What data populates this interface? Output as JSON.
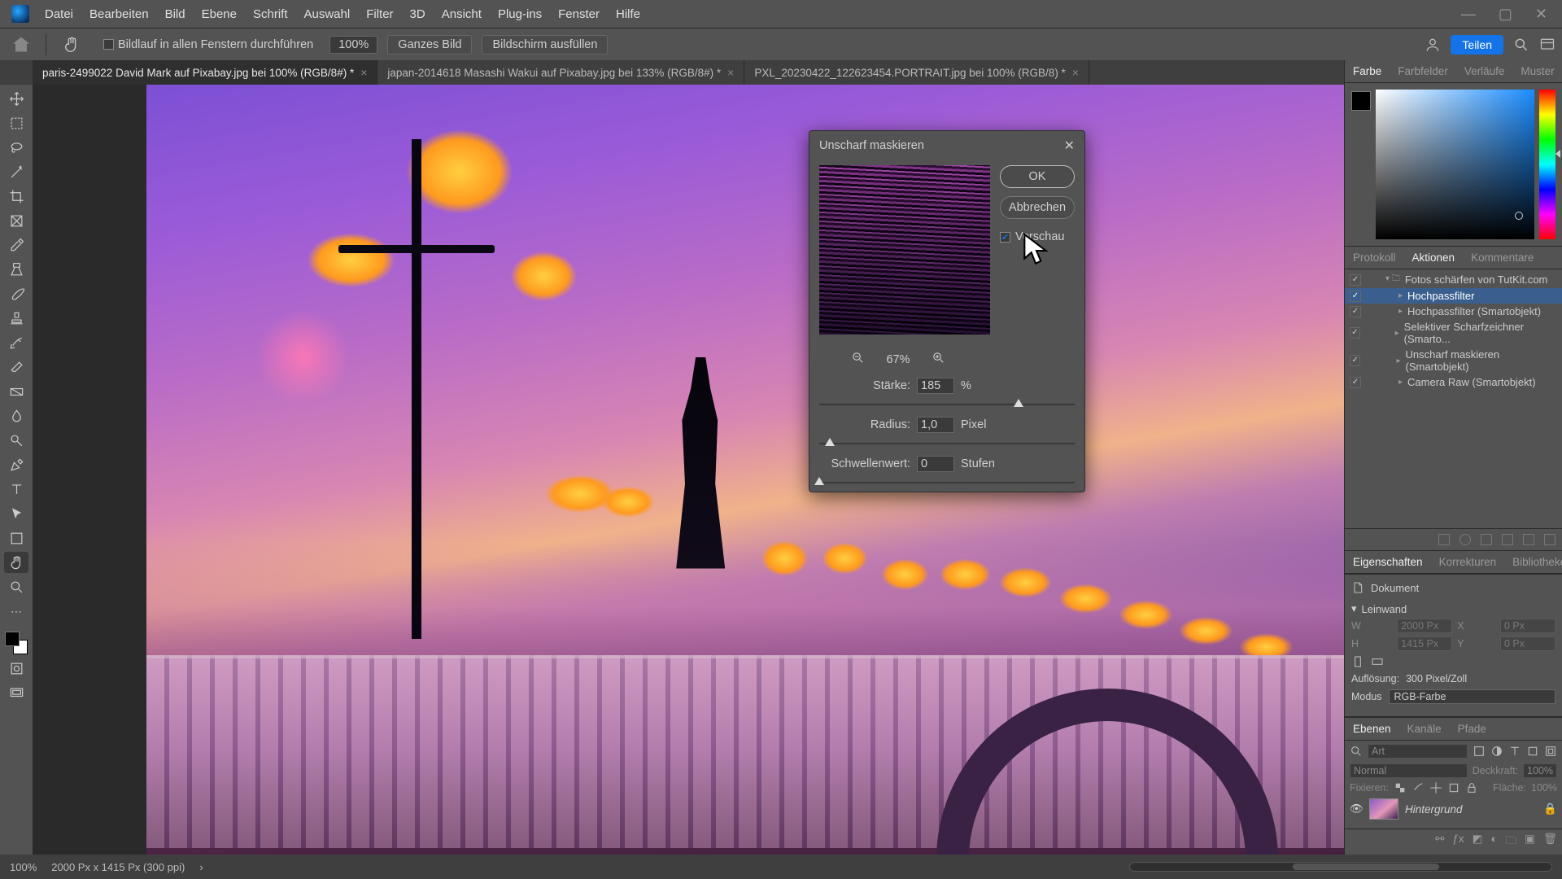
{
  "menu": {
    "items": [
      "Datei",
      "Bearbeiten",
      "Bild",
      "Ebene",
      "Schrift",
      "Auswahl",
      "Filter",
      "3D",
      "Ansicht",
      "Plug-ins",
      "Fenster",
      "Hilfe"
    ]
  },
  "optbar": {
    "scroll_all_label": "Bildlauf in allen Fenstern durchführen",
    "zoom": "100%",
    "whole_image": "Ganzes Bild",
    "fit_screen": "Bildschirm ausfüllen",
    "share": "Teilen"
  },
  "tabs": [
    {
      "label": "paris-2499022  David Mark auf Pixabay.jpg bei 100% (RGB/8#) *",
      "active": true
    },
    {
      "label": "japan-2014618 Masashi Wakui auf Pixabay.jpg bei 133% (RGB/8#) *",
      "active": false
    },
    {
      "label": "PXL_20230422_122623454.PORTRAIT.jpg bei 100% (RGB/8) *",
      "active": false
    }
  ],
  "dialog": {
    "title": "Unscharf maskieren",
    "ok": "OK",
    "cancel": "Abbrechen",
    "preview_chk": "Vorschau",
    "zoom": "67%",
    "strength_label": "Stärke:",
    "strength_val": "185",
    "strength_unit": "%",
    "radius_label": "Radius:",
    "radius_val": "1,0",
    "radius_unit": "Pixel",
    "threshold_label": "Schwellenwert:",
    "threshold_val": "0",
    "threshold_unit": "Stufen"
  },
  "right": {
    "color_tabs": [
      "Farbe",
      "Farbfelder",
      "Verläufe",
      "Muster"
    ],
    "history_tabs": [
      "Protokoll",
      "Aktionen",
      "Kommentare"
    ],
    "actions_root": "Fotos schärfen von TutKit.com",
    "actions": [
      "Hochpassfilter",
      "Hochpassfilter (Smartobjekt)",
      "Selektiver Scharfzeichner (Smarto...",
      "Unscharf maskieren (Smartobjekt)",
      "Camera Raw (Smartobjekt)"
    ],
    "props_tabs": [
      "Eigenschaften",
      "Korrekturen",
      "Bibliotheken"
    ],
    "props_doc": "Dokument",
    "props_canvas": "Leinwand",
    "dim_labels": {
      "w": "W",
      "h": "H",
      "x": "X",
      "y": "Y"
    },
    "dim_vals": {
      "w": "2000 Px",
      "h": "1415 Px",
      "x": "0 Px",
      "y": "0 Px"
    },
    "resolution_label": "Auflösung:",
    "resolution_val": "300 Pixel/Zoll",
    "mode_label": "Modus",
    "mode_val": "RGB-Farbe",
    "layer_tabs": [
      "Ebenen",
      "Kanäle",
      "Pfade"
    ],
    "layer_kind": "Art",
    "layer_blend": "Normal",
    "opacity_label": "Deckkraft:",
    "opacity_val": "100%",
    "lock_label": "Fixieren:",
    "fill_label": "Fläche:",
    "fill_val": "100%",
    "layer_name": "Hintergrund"
  },
  "status": {
    "zoom": "100%",
    "dims": "2000 Px x 1415 Px (300 ppi)"
  }
}
